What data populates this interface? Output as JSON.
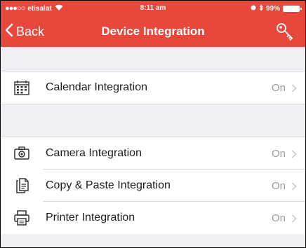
{
  "status_bar": {
    "carrier": "etisalat",
    "time": "8:11 am",
    "battery": "99%"
  },
  "nav": {
    "back_label": "Back",
    "title": "Device Integration"
  },
  "sections": [
    {
      "rows": [
        {
          "label": "Calendar Integration",
          "value": "On",
          "icon": "calendar-icon"
        }
      ]
    },
    {
      "rows": [
        {
          "label": "Camera Integration",
          "value": "On",
          "icon": "camera-icon"
        },
        {
          "label": "Copy & Paste Integration",
          "value": "On",
          "icon": "copy-paste-icon"
        },
        {
          "label": "Printer Integration",
          "value": "On",
          "icon": "printer-icon"
        }
      ]
    }
  ],
  "colors": {
    "accent": "#e8473b",
    "background": "#efeff4",
    "value_text": "#9a9aa0"
  }
}
